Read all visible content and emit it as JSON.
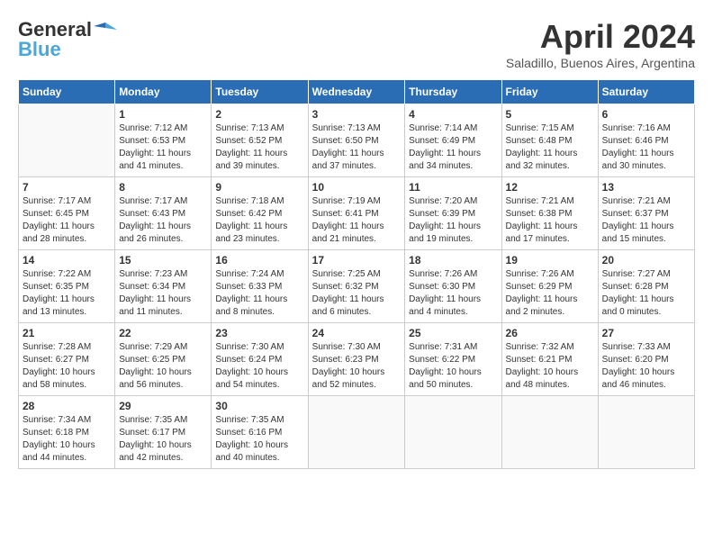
{
  "header": {
    "logo_general": "General",
    "logo_blue": "Blue",
    "month_title": "April 2024",
    "subtitle": "Saladillo, Buenos Aires, Argentina"
  },
  "days_of_week": [
    "Sunday",
    "Monday",
    "Tuesday",
    "Wednesday",
    "Thursday",
    "Friday",
    "Saturday"
  ],
  "weeks": [
    [
      {
        "day": "",
        "info": ""
      },
      {
        "day": "1",
        "info": "Sunrise: 7:12 AM\nSunset: 6:53 PM\nDaylight: 11 hours\nand 41 minutes."
      },
      {
        "day": "2",
        "info": "Sunrise: 7:13 AM\nSunset: 6:52 PM\nDaylight: 11 hours\nand 39 minutes."
      },
      {
        "day": "3",
        "info": "Sunrise: 7:13 AM\nSunset: 6:50 PM\nDaylight: 11 hours\nand 37 minutes."
      },
      {
        "day": "4",
        "info": "Sunrise: 7:14 AM\nSunset: 6:49 PM\nDaylight: 11 hours\nand 34 minutes."
      },
      {
        "day": "5",
        "info": "Sunrise: 7:15 AM\nSunset: 6:48 PM\nDaylight: 11 hours\nand 32 minutes."
      },
      {
        "day": "6",
        "info": "Sunrise: 7:16 AM\nSunset: 6:46 PM\nDaylight: 11 hours\nand 30 minutes."
      }
    ],
    [
      {
        "day": "7",
        "info": "Sunrise: 7:17 AM\nSunset: 6:45 PM\nDaylight: 11 hours\nand 28 minutes."
      },
      {
        "day": "8",
        "info": "Sunrise: 7:17 AM\nSunset: 6:43 PM\nDaylight: 11 hours\nand 26 minutes."
      },
      {
        "day": "9",
        "info": "Sunrise: 7:18 AM\nSunset: 6:42 PM\nDaylight: 11 hours\nand 23 minutes."
      },
      {
        "day": "10",
        "info": "Sunrise: 7:19 AM\nSunset: 6:41 PM\nDaylight: 11 hours\nand 21 minutes."
      },
      {
        "day": "11",
        "info": "Sunrise: 7:20 AM\nSunset: 6:39 PM\nDaylight: 11 hours\nand 19 minutes."
      },
      {
        "day": "12",
        "info": "Sunrise: 7:21 AM\nSunset: 6:38 PM\nDaylight: 11 hours\nand 17 minutes."
      },
      {
        "day": "13",
        "info": "Sunrise: 7:21 AM\nSunset: 6:37 PM\nDaylight: 11 hours\nand 15 minutes."
      }
    ],
    [
      {
        "day": "14",
        "info": "Sunrise: 7:22 AM\nSunset: 6:35 PM\nDaylight: 11 hours\nand 13 minutes."
      },
      {
        "day": "15",
        "info": "Sunrise: 7:23 AM\nSunset: 6:34 PM\nDaylight: 11 hours\nand 11 minutes."
      },
      {
        "day": "16",
        "info": "Sunrise: 7:24 AM\nSunset: 6:33 PM\nDaylight: 11 hours\nand 8 minutes."
      },
      {
        "day": "17",
        "info": "Sunrise: 7:25 AM\nSunset: 6:32 PM\nDaylight: 11 hours\nand 6 minutes."
      },
      {
        "day": "18",
        "info": "Sunrise: 7:26 AM\nSunset: 6:30 PM\nDaylight: 11 hours\nand 4 minutes."
      },
      {
        "day": "19",
        "info": "Sunrise: 7:26 AM\nSunset: 6:29 PM\nDaylight: 11 hours\nand 2 minutes."
      },
      {
        "day": "20",
        "info": "Sunrise: 7:27 AM\nSunset: 6:28 PM\nDaylight: 11 hours\nand 0 minutes."
      }
    ],
    [
      {
        "day": "21",
        "info": "Sunrise: 7:28 AM\nSunset: 6:27 PM\nDaylight: 10 hours\nand 58 minutes."
      },
      {
        "day": "22",
        "info": "Sunrise: 7:29 AM\nSunset: 6:25 PM\nDaylight: 10 hours\nand 56 minutes."
      },
      {
        "day": "23",
        "info": "Sunrise: 7:30 AM\nSunset: 6:24 PM\nDaylight: 10 hours\nand 54 minutes."
      },
      {
        "day": "24",
        "info": "Sunrise: 7:30 AM\nSunset: 6:23 PM\nDaylight: 10 hours\nand 52 minutes."
      },
      {
        "day": "25",
        "info": "Sunrise: 7:31 AM\nSunset: 6:22 PM\nDaylight: 10 hours\nand 50 minutes."
      },
      {
        "day": "26",
        "info": "Sunrise: 7:32 AM\nSunset: 6:21 PM\nDaylight: 10 hours\nand 48 minutes."
      },
      {
        "day": "27",
        "info": "Sunrise: 7:33 AM\nSunset: 6:20 PM\nDaylight: 10 hours\nand 46 minutes."
      }
    ],
    [
      {
        "day": "28",
        "info": "Sunrise: 7:34 AM\nSunset: 6:18 PM\nDaylight: 10 hours\nand 44 minutes."
      },
      {
        "day": "29",
        "info": "Sunrise: 7:35 AM\nSunset: 6:17 PM\nDaylight: 10 hours\nand 42 minutes."
      },
      {
        "day": "30",
        "info": "Sunrise: 7:35 AM\nSunset: 6:16 PM\nDaylight: 10 hours\nand 40 minutes."
      },
      {
        "day": "",
        "info": ""
      },
      {
        "day": "",
        "info": ""
      },
      {
        "day": "",
        "info": ""
      },
      {
        "day": "",
        "info": ""
      }
    ]
  ]
}
